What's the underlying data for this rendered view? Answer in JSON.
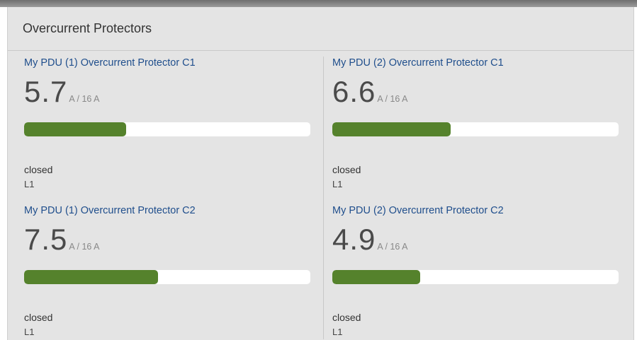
{
  "panel": {
    "title": "Overcurrent Protectors"
  },
  "colors": {
    "panel_bg": "#e4e4e4",
    "title_link": "#1f4e8c",
    "bar_fill": "#55822c",
    "bar_track": "#ffffff"
  },
  "protectors": [
    {
      "name": "My PDU (1) Overcurrent Protector C1",
      "current": "5.7",
      "unit_rating": "A / 16 A",
      "fill_fraction": 0.356,
      "state": "closed",
      "line": "L1"
    },
    {
      "name": "My PDU (2) Overcurrent Protector C1",
      "current": "6.6",
      "unit_rating": "A / 16 A",
      "fill_fraction": 0.4125,
      "state": "closed",
      "line": "L1"
    },
    {
      "name": "My PDU (1) Overcurrent Protector C2",
      "current": "7.5",
      "unit_rating": "A / 16 A",
      "fill_fraction": 0.46875,
      "state": "closed",
      "line": "L1"
    },
    {
      "name": "My PDU (2) Overcurrent Protector C2",
      "current": "4.9",
      "unit_rating": "A / 16 A",
      "fill_fraction": 0.30625,
      "state": "closed",
      "line": "L1"
    }
  ]
}
